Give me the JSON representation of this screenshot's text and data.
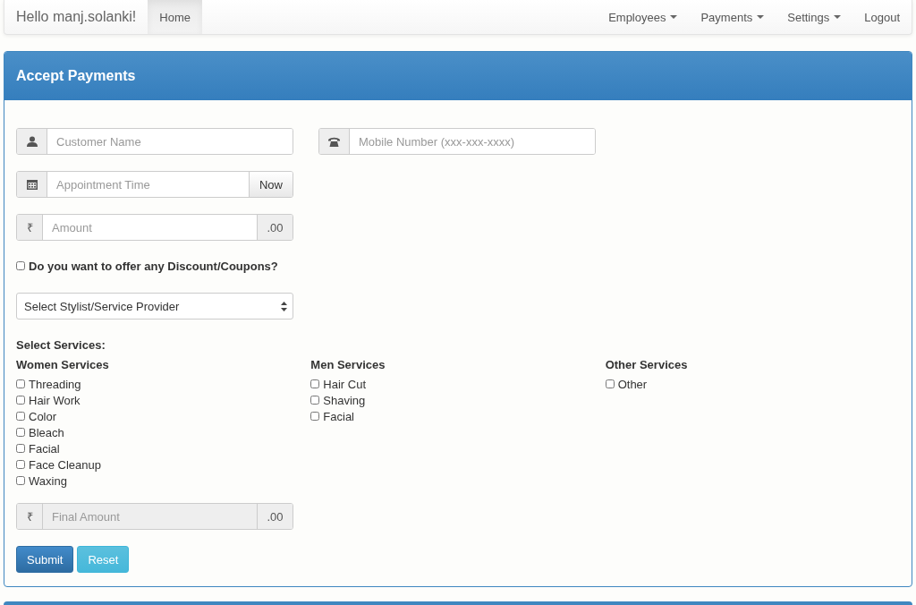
{
  "navbar": {
    "brand": "Hello manj.solanki!",
    "left_items": [
      {
        "label": "Home",
        "selected": true,
        "dropdown": false
      }
    ],
    "right_items": [
      {
        "label": "Employees",
        "selected": false,
        "dropdown": true
      },
      {
        "label": "Payments",
        "selected": false,
        "dropdown": true
      },
      {
        "label": "Settings",
        "selected": false,
        "dropdown": true
      },
      {
        "label": "Logout",
        "selected": false,
        "dropdown": false
      }
    ]
  },
  "panel": {
    "title": "Accept Payments",
    "contact_fields": [
      {
        "placeholder": "Customer Name",
        "disabled": false
      },
      {
        "placeholder": "Mobile Number (xxx-xxx-xxxx)",
        "disabled": false
      }
    ],
    "appointment": {
      "placeholder": "Appointment Time",
      "button": "Now"
    },
    "amount": {
      "prefix": "₹",
      "placeholder": "Amount",
      "suffix": ".00",
      "disabled": false
    },
    "discount": {
      "label": "Do you want to offer any Discount/Coupons?",
      "checked": false
    },
    "stylist_select": {
      "value": "Select Stylist/Service Provider"
    },
    "services_label": "Select Services:",
    "service_groups": [
      {
        "title": "Women Services",
        "items": [
          {
            "label": "Threading",
            "checked": false
          },
          {
            "label": "Hair Work",
            "checked": false
          },
          {
            "label": "Color",
            "checked": false
          },
          {
            "label": "Bleach",
            "checked": false
          },
          {
            "label": "Facial",
            "checked": false
          },
          {
            "label": "Face Cleanup",
            "checked": false
          },
          {
            "label": "Waxing",
            "checked": false
          }
        ]
      },
      {
        "title": "Men Services",
        "items": [
          {
            "label": "Hair Cut",
            "checked": false
          },
          {
            "label": "Shaving",
            "checked": false
          },
          {
            "label": "Facial",
            "checked": false
          }
        ]
      },
      {
        "title": "Other Services",
        "items": [
          {
            "label": "Other",
            "checked": false
          }
        ]
      }
    ],
    "final_amount": {
      "prefix": "₹",
      "placeholder": "Final Amount",
      "suffix": ".00",
      "disabled": true
    },
    "buttons": [
      {
        "label": "Submit",
        "kind": "primary"
      },
      {
        "label": "Reset",
        "kind": "info"
      }
    ]
  }
}
